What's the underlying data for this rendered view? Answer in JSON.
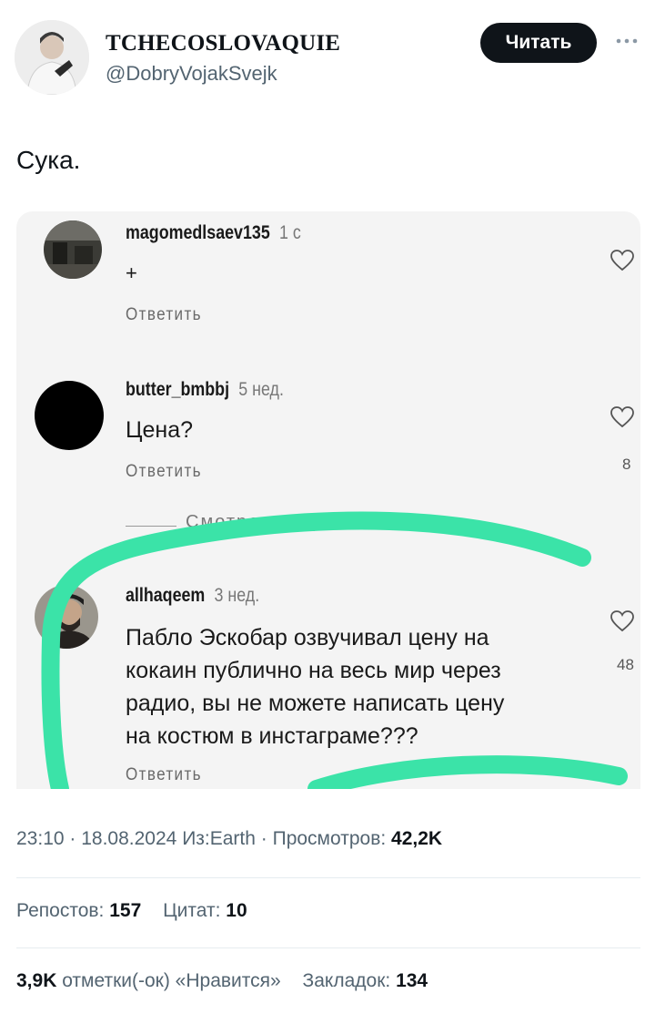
{
  "author": {
    "display_name": "TCHECOSLOVAQUIE",
    "handle": "@DobryVojakSvejk",
    "avatar_icon": "profile-photo"
  },
  "follow_label": "Читать",
  "more_icon": "ellipsis-icon",
  "tweet_text": "Сука.",
  "embedded_comments": [
    {
      "username": "magomedlsaev135",
      "time": "1 с",
      "text": "+",
      "reply_label": "Ответить"
    },
    {
      "username": "butter_bmbbj",
      "time": "5 нед.",
      "text": "Цена?",
      "reply_label": "Ответить",
      "like_count": "8"
    },
    {
      "view_replies": "Смотреть ещё 4 ответа"
    },
    {
      "username": "allhaqeem",
      "time": "3 нед.",
      "text_lines": [
        "Пабло Эскобар озвучивал цену на",
        "кокаин публично на весь мир через",
        "радио, вы не можете написать цену",
        "на костюм в инстаграме???"
      ],
      "reply_label": "Ответить",
      "like_count": "48"
    }
  ],
  "meta": {
    "time": "23:10",
    "date": "18.08.2024",
    "source": "Из:Earth",
    "views_label": "Просмотров:",
    "views_value": "42,2K"
  },
  "stats": {
    "reposts_label": "Репостов:",
    "reposts_value": "157",
    "quotes_label": "Цитат:",
    "quotes_value": "10",
    "likes_value": "3,9K",
    "likes_label": "отметки(-ок) «Нравится»",
    "bookmarks_label": "Закладок:",
    "bookmarks_value": "134"
  },
  "colors": {
    "highlight_stroke": "#3be3a8",
    "follow_button": "#0f1419",
    "secondary_text": "#536471"
  }
}
